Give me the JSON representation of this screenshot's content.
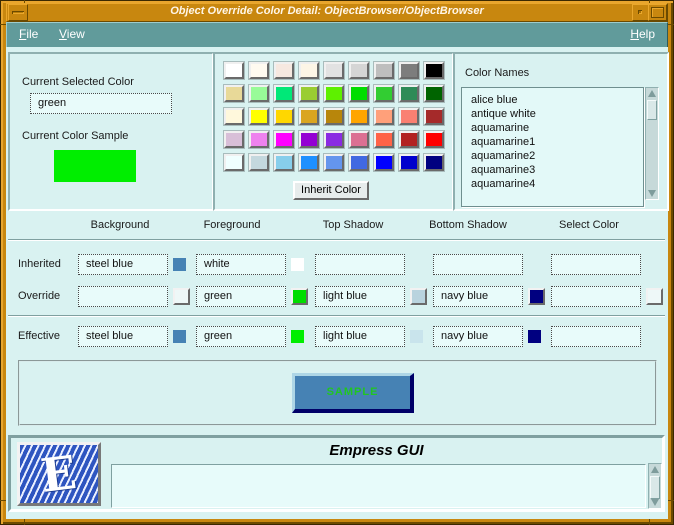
{
  "window": {
    "title": "Object Override Color Detail: ObjectBrowser/ObjectBrowser",
    "menu": {
      "file": "File",
      "view": "View",
      "help": "Help"
    }
  },
  "left_panel": {
    "selected_color_label": "Current Selected Color",
    "selected_color_value": "green",
    "sample_label": "Current Color Sample",
    "sample_color": "#00ee00"
  },
  "palette": {
    "inherit_button_label": "Inherit Color",
    "rows": [
      [
        "#ffffff",
        "#fffaf0",
        "#f6e8e0",
        "#fdf5e6",
        "#e2e2e2",
        "#d5d5d5",
        "#bebebe",
        "#7d7d7d",
        "#000000"
      ],
      [
        "#e8d998",
        "#98fb98",
        "#00e878",
        "#9acd32",
        "#5ef000",
        "#00dd00",
        "#32cd32",
        "#2e8b57",
        "#006400"
      ],
      [
        "#fff8dc",
        "#ffff00",
        "#ffd700",
        "#daa520",
        "#b8860b",
        "#ffa500",
        "#ffa07a",
        "#fa8072",
        "#a52a2a"
      ],
      [
        "#d8bfd8",
        "#ee82ee",
        "#ff00ff",
        "#9400d3",
        "#8a2be2",
        "#db7093",
        "#ff6347",
        "#b22222",
        "#ff0000"
      ],
      [
        "#f0ffff",
        "#c4d8de",
        "#87ceeb",
        "#1e90ff",
        "#6495ed",
        "#4169e1",
        "#0000ff",
        "#0000cd",
        "#000080"
      ]
    ]
  },
  "color_names": {
    "label": "Color Names",
    "items": [
      "alice blue",
      "antique white",
      "aquamarine",
      "aquamarine1",
      "aquamarine2",
      "aquamarine3",
      "aquamarine4"
    ]
  },
  "table": {
    "columns": [
      "Background",
      "Foreground",
      "Top Shadow",
      "Bottom Shadow",
      "Select Color"
    ],
    "rows": [
      {
        "label": "Inherited",
        "style": "flat",
        "cells": [
          {
            "text": "steel blue",
            "swatch": "#4682b4"
          },
          {
            "text": "white",
            "swatch": "#ffffff"
          },
          {
            "text": ""
          },
          {
            "text": ""
          },
          {
            "text": ""
          }
        ]
      },
      {
        "label": "Override",
        "style": "raised",
        "cells": [
          {
            "text": "",
            "swatch": "blank"
          },
          {
            "text": "green",
            "swatch": "#00dd00"
          },
          {
            "text": "light blue",
            "swatch": "#b9d3de"
          },
          {
            "text": "navy blue",
            "swatch": "#000080"
          },
          {
            "text": "",
            "swatch": "blank"
          }
        ]
      },
      {
        "label": "Effective",
        "style": "flat",
        "cells": [
          {
            "text": "steel blue",
            "swatch": "#4682b4"
          },
          {
            "text": "green",
            "swatch": "#00ee00"
          },
          {
            "text": "light blue",
            "swatch": "#c9e4ec"
          },
          {
            "text": "navy blue",
            "swatch": "#000080"
          },
          {
            "text": ""
          }
        ]
      }
    ]
  },
  "sample": {
    "label": "SAMPLE",
    "bg": "#4682b4",
    "fg": "#21c621",
    "top_shadow": "#aed6e6",
    "bottom_shadow": "#000068"
  },
  "footer": {
    "title": "Empress GUI",
    "logo_letter": "E",
    "message": ""
  }
}
